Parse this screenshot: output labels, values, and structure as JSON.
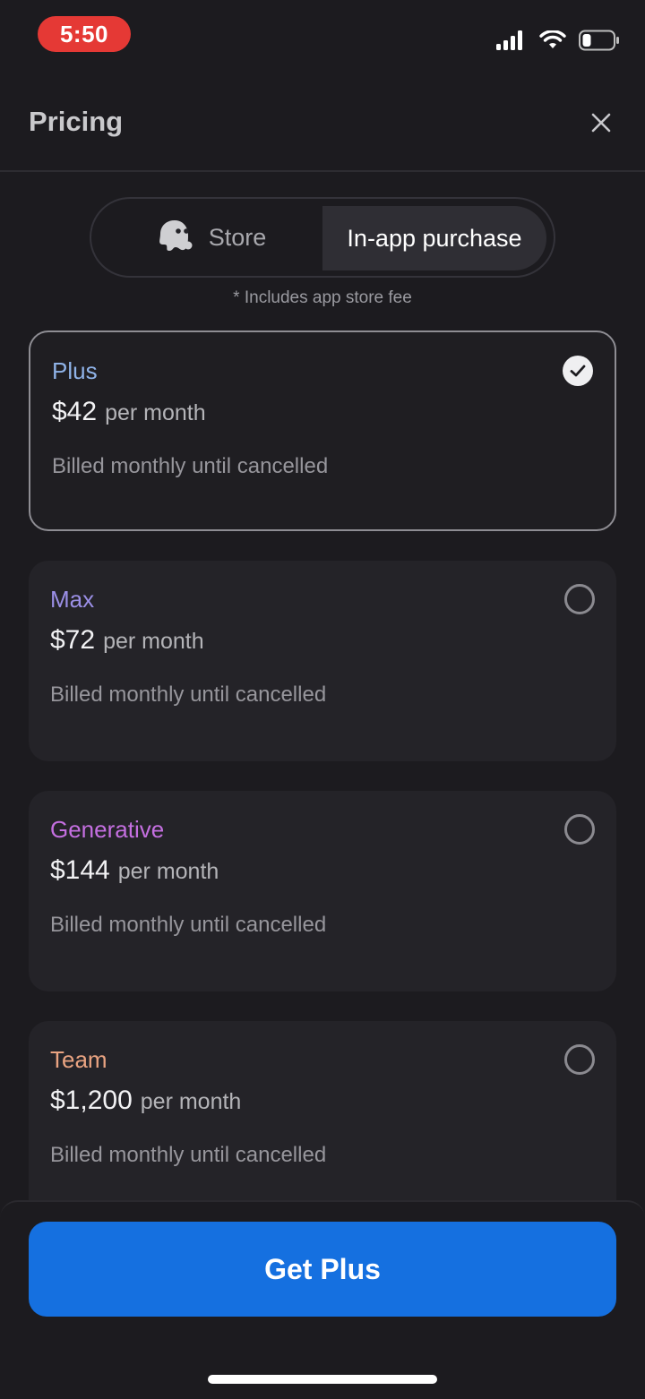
{
  "status_bar": {
    "time": "5:50",
    "icons": [
      "signal-icon",
      "wifi-icon",
      "battery-icon"
    ],
    "time_pill_color": "#e53935"
  },
  "header": {
    "title": "Pricing",
    "close_icon": "close-icon"
  },
  "segmented_control": {
    "store_label": "Store",
    "store_icon": "ghost-icon",
    "in_app_label": "In-app purchase",
    "selected": "In-app purchase"
  },
  "fee_note": "* Includes app store fee",
  "plans": [
    {
      "name": "Plus",
      "price": "$42",
      "period": "per month",
      "billing": "Billed monthly until cancelled",
      "selected": true,
      "color": "#8fb3e8"
    },
    {
      "name": "Max",
      "price": "$72",
      "period": "per month",
      "billing": "Billed monthly until cancelled",
      "selected": false,
      "color": "#9b8fe6"
    },
    {
      "name": "Generative",
      "price": "$144",
      "period": "per month",
      "billing": "Billed monthly until cancelled",
      "selected": false,
      "color": "#c46fe0"
    },
    {
      "name": "Team",
      "price": "$1,200",
      "period": "per month",
      "billing": "Billed monthly until cancelled",
      "selected": false,
      "color": "#e9a381"
    }
  ],
  "cta": {
    "label": "Get Plus",
    "color": "#1570e0"
  }
}
